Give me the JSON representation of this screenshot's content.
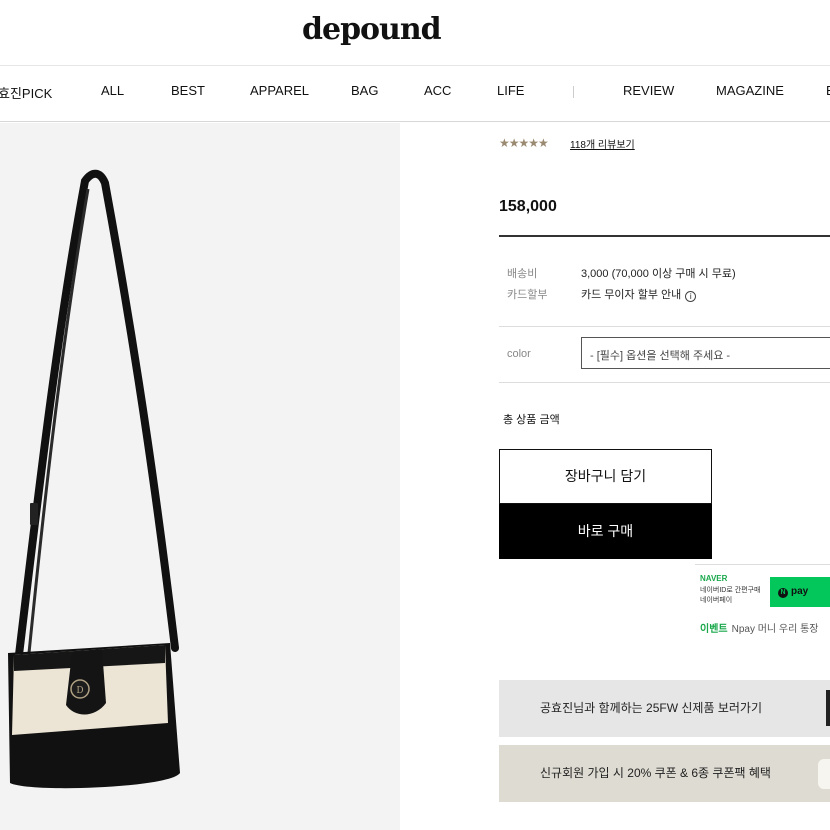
{
  "brand": {
    "logo_text": "depound"
  },
  "nav": {
    "items": [
      "효진PICK",
      "ALL",
      "BEST",
      "APPAREL",
      "BAG",
      "ACC",
      "LIFE",
      "REVIEW",
      "MAGAZINE",
      "B"
    ]
  },
  "product": {
    "rating_stars": "★★★★★",
    "rating_value": 4.5,
    "review_link": "118개 리뷰보기",
    "price": "158,000",
    "shipping_label": "배송비",
    "shipping_value": "3,000 (70,000 이상 구매 시 무료)",
    "card_label": "카드할부",
    "card_value": "카드 무이자 할부 안내",
    "card_info_icon": "i",
    "option_label": "color",
    "option_placeholder": "- [필수] 옵션을 선택해 주세요 -",
    "total_label": "총 상품 금액"
  },
  "actions": {
    "cart_label": "장바구니 담기",
    "buy_label": "바로 구매"
  },
  "npay": {
    "brand": "NAVER",
    "sub1": "네이버ID로 간편구매",
    "sub2": "네이버페이",
    "button_label": "pay",
    "event_tag": "이벤트",
    "event_text": "Npay 머니 우리 통장"
  },
  "banners": [
    "공효진님과 함께하는 25FW 신제품 보러가기",
    "신규회원 가입 시 20% 쿠폰 & 6종 쿠폰팩 혜택"
  ],
  "colors": {
    "star": "#9b8a72",
    "naver_green": "#03c75a",
    "banner1_bg": "#e6e6e6",
    "banner2_bg": "#dedbd2"
  }
}
